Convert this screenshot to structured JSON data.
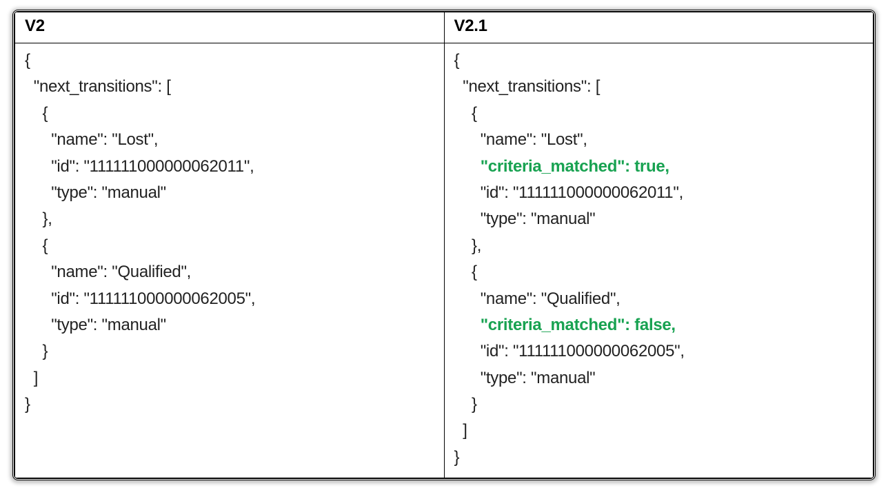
{
  "headers": {
    "left": "V2",
    "right": "V2.1"
  },
  "highlight_color": "#18a251",
  "code_left": [
    {
      "t": "{"
    },
    {
      "t": "  \"next_transitions\": ["
    },
    {
      "t": "    {"
    },
    {
      "t": "      \"name\": \"Lost\","
    },
    {
      "t": "      \"id\": \"111111000000062011\","
    },
    {
      "t": "      \"type\": \"manual\""
    },
    {
      "t": "    },"
    },
    {
      "t": "    {"
    },
    {
      "t": "      \"name\": \"Qualified\","
    },
    {
      "t": "      \"id\": \"111111000000062005\","
    },
    {
      "t": "      \"type\": \"manual\""
    },
    {
      "t": "    }"
    },
    {
      "t": "  ]"
    },
    {
      "t": "}"
    }
  ],
  "code_right": [
    {
      "t": "{"
    },
    {
      "t": "  \"next_transitions\": ["
    },
    {
      "t": "    {"
    },
    {
      "t": "      \"name\": \"Lost\","
    },
    {
      "t": "      \"criteria_matched\": true,",
      "hl": true,
      "indent": "      "
    },
    {
      "t": "      \"id\": \"111111000000062011\","
    },
    {
      "t": "      \"type\": \"manual\""
    },
    {
      "t": "    },"
    },
    {
      "t": "    {"
    },
    {
      "t": "      \"name\": \"Qualified\","
    },
    {
      "t": "      \"criteria_matched\": false,",
      "hl": true,
      "indent": "      "
    },
    {
      "t": "      \"id\": \"111111000000062005\","
    },
    {
      "t": "      \"type\": \"manual\""
    },
    {
      "t": "    }"
    },
    {
      "t": "  ]"
    },
    {
      "t": "}"
    }
  ]
}
